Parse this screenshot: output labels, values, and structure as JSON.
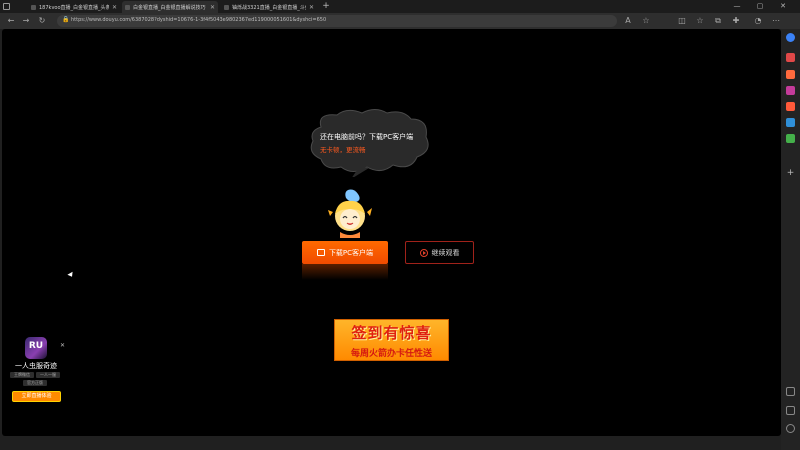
{
  "browser": {
    "tabs": [
      {
        "title": "187kvoo直播_白金银直播_头条直播",
        "active": false
      },
      {
        "title": "白金银直播_白金银直播解说技巧",
        "active": true
      },
      {
        "title": "铀烁战3321直播_白金银直播_斗鱼",
        "active": false
      }
    ],
    "url": "https://www.douyu.com/6387028?dyshid=10676-1-3f4f5043e9802367ed119000051601&dyshci=650"
  },
  "colors": {
    "accent": "#ff5a1f",
    "download_button": "#ff6a00",
    "continue_border": "#a0221a",
    "background": "#000000"
  },
  "prompt": {
    "line1": "还在电脑前吗？下载PC客户端",
    "line2": "无卡顿，更流畅"
  },
  "buttons": {
    "download": "下载PC客户端",
    "continue": "继续观看"
  },
  "banner": {
    "title": "签到有惊喜",
    "subtitle": "每周火箭办卡任性送"
  },
  "ad": {
    "logo_text": "RU",
    "title": "一人虫服奇迹",
    "tags": [
      "王牌微信",
      "一人一服",
      "官方正版"
    ],
    "button": "立即直播体验"
  },
  "icons": {
    "back": "back-arrow-icon",
    "forward": "forward-arrow-icon",
    "refresh": "refresh-icon",
    "lock": "lock-icon",
    "favorite": "star-icon",
    "close": "close-icon"
  }
}
